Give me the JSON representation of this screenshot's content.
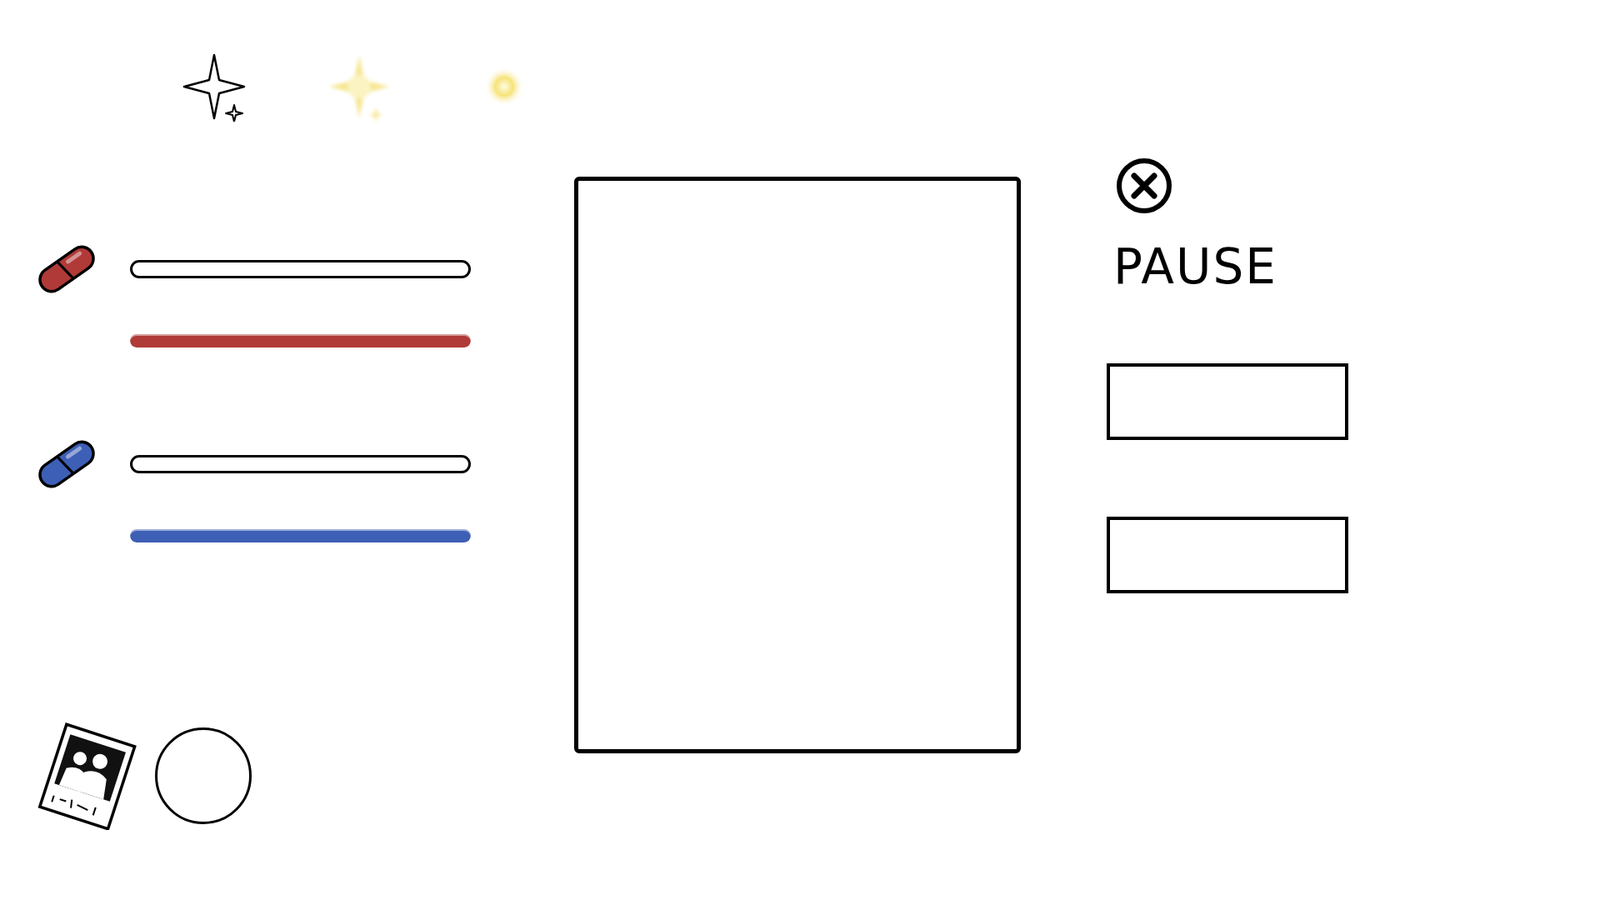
{
  "stars": [
    {
      "kind": "sparkle",
      "lit": false
    },
    {
      "kind": "sparkle",
      "lit": true
    },
    {
      "kind": "dot",
      "lit": true
    }
  ],
  "stats": [
    {
      "color": "#b03a37",
      "bars": [
        {
          "kind": "outlined",
          "level": 0
        },
        {
          "kind": "solid",
          "level": 1
        }
      ]
    },
    {
      "color": "#3d5fb5",
      "bars": [
        {
          "kind": "outlined",
          "level": 0
        },
        {
          "kind": "solid",
          "level": 1
        }
      ]
    }
  ],
  "pause_menu": {
    "title": "PAUSE",
    "buttons": [
      {
        "label": ""
      },
      {
        "label": ""
      }
    ]
  }
}
